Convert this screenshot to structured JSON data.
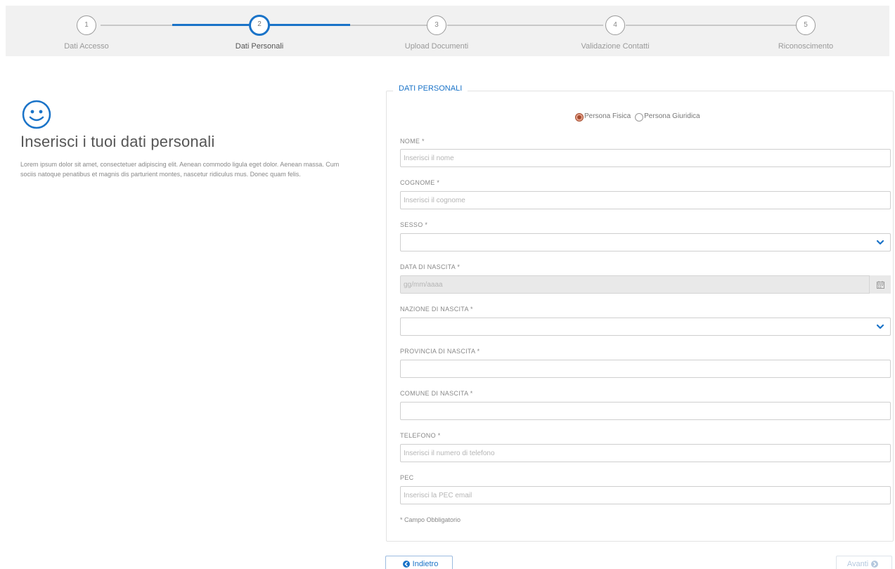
{
  "stepper": {
    "steps": [
      {
        "number": "1",
        "label": "Dati Accesso"
      },
      {
        "number": "2",
        "label": "Dati Personali"
      },
      {
        "number": "3",
        "label": "Upload Documenti"
      },
      {
        "number": "4",
        "label": "Validazione Contatti"
      },
      {
        "number": "5",
        "label": "Riconoscimento"
      }
    ],
    "active_step": 2
  },
  "intro": {
    "icon": "smiley-icon",
    "title": "Inserisci i tuoi dati personali",
    "text": "Lorem ipsum dolor sit amet, consectetuer adipiscing elit. Aenean commodo ligula eget dolor. Aenean massa. Cum sociis natoque penatibus et magnis dis parturient montes, nascetur ridiculus mus. Donec quam felis."
  },
  "form": {
    "legend": "DATI PERSONALI",
    "person_type": {
      "options": [
        "Persona Fisica",
        "Persona Giuridica"
      ],
      "selected": "Persona Fisica"
    },
    "fields": {
      "nome": {
        "label": "NOME *",
        "placeholder": "Inserisci il nome"
      },
      "cognome": {
        "label": "COGNOME *",
        "placeholder": "Inserisci il cognome"
      },
      "sesso": {
        "label": "SESSO *",
        "value": ""
      },
      "data_nascita": {
        "label": "DATA DI NASCITA *",
        "placeholder": "gg/mm/aaaa"
      },
      "nazione": {
        "label": "NAZIONE DI NASCITA *",
        "value": ""
      },
      "provincia": {
        "label": "PROVINCIA DI NASCITA *",
        "value": ""
      },
      "comune": {
        "label": "COMUNE DI NASCITA *",
        "value": ""
      },
      "telefono": {
        "label": "TELEFONO *",
        "placeholder": "Inserisci il numero di telefono"
      },
      "pec": {
        "label": "PEC",
        "placeholder": "Inserisci la PEC email"
      }
    },
    "required_note": "* Campo Obbligatorio"
  },
  "buttons": {
    "back": "Indietro",
    "next": "Avanti"
  },
  "colors": {
    "accent": "#1a73c8",
    "radio_checked": "#a44a2c",
    "stepper_bg": "#f1f1f1"
  }
}
